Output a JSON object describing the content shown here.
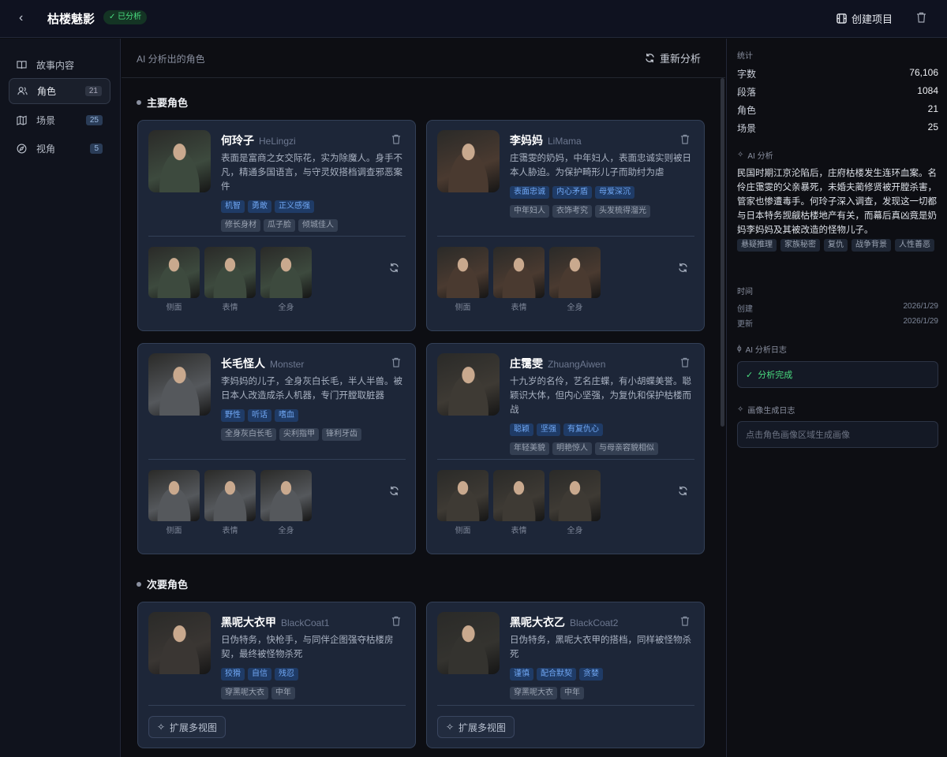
{
  "header": {
    "title": "枯楼魅影",
    "status_badge": "已分析",
    "create_label": "创建项目"
  },
  "sidebar": {
    "items": [
      {
        "label": "故事内容",
        "count": null,
        "icon": "book-icon"
      },
      {
        "label": "角色",
        "count": "21",
        "icon": "users-icon"
      },
      {
        "label": "场景",
        "count": "25",
        "icon": "map-icon"
      },
      {
        "label": "视角",
        "count": "5",
        "icon": "compass-icon"
      }
    ]
  },
  "main": {
    "subtitle": "AI 分析出的角色",
    "reanalyze_label": "重新分析",
    "primary_title": "主要角色",
    "secondary_title": "次要角色",
    "view_labels": [
      "侧面",
      "表情",
      "全身"
    ],
    "expand_label": "扩展多视图",
    "primary": [
      {
        "name": "何玲子",
        "en": "HeLingzi",
        "desc": "表面是富商之女交际花，实为除魔人。身手不凡，精通多国语言，与守灵奴搭档调查邪恶案件",
        "traits": [
          "机智",
          "勇敢",
          "正义感强"
        ],
        "looks": [
          "修长身材",
          "瓜子脸",
          "倾城佳人"
        ],
        "color": "#3d4a3e"
      },
      {
        "name": "李妈妈",
        "en": "LiMama",
        "desc": "庄霭雯的奶妈，中年妇人，表面忠诚实则被日本人胁迫。为保护畸形儿子而助纣为虐",
        "traits": [
          "表面忠诚",
          "内心矛盾",
          "母爱深沉"
        ],
        "looks": [
          "中年妇人",
          "衣饰考究",
          "头发梳得溜光"
        ],
        "color": "#4a3a30"
      },
      {
        "name": "长毛怪人",
        "en": "Monster",
        "desc": "李妈妈的儿子，全身灰白长毛，半人半兽。被日本人改造成杀人机器，专门开膛取脏器",
        "traits": [
          "野性",
          "听话",
          "嗜血"
        ],
        "looks": [
          "全身灰白长毛",
          "尖利指甲",
          "锋利牙齿"
        ],
        "color": "#55585c"
      },
      {
        "name": "庄霭雯",
        "en": "ZhuangAiwen",
        "desc": "十九岁的名伶，艺名庄蝶，有小胡蝶美誉。聪颖识大体，但内心坚强，为复仇和保护枯楼而战",
        "traits": [
          "聪颖",
          "坚强",
          "有复仇心"
        ],
        "looks": [
          "年轻美貌",
          "明艳惊人",
          "与母亲容貌相似"
        ],
        "color": "#3e3a34"
      }
    ],
    "secondary": [
      {
        "name": "黑呢大衣甲",
        "en": "BlackCoat1",
        "desc": "日伪特务，快枪手，与同伴企图强夺枯楼房契，最终被怪物杀死",
        "traits": [
          "狡猾",
          "自信",
          "残忍"
        ],
        "looks": [
          "穿黑呢大衣",
          "中年"
        ],
        "color": "#3a3633"
      },
      {
        "name": "黑呢大衣乙",
        "en": "BlackCoat2",
        "desc": "日伪特务，黑呢大衣甲的搭档，同样被怪物杀死",
        "traits": [
          "谨慎",
          "配合默契",
          "贪婪"
        ],
        "looks": [
          "穿黑呢大衣",
          "中年"
        ],
        "color": "#34332f"
      }
    ]
  },
  "right": {
    "stats_title": "统计",
    "stats": [
      {
        "label": "字数",
        "value": "76,106"
      },
      {
        "label": "段落",
        "value": "1084"
      },
      {
        "label": "角色",
        "value": "21"
      },
      {
        "label": "场景",
        "value": "25"
      }
    ],
    "ai_title": "AI 分析",
    "summary": "民国时期江京沦陷后，庄府枯楼发生连环血案。名伶庄霭雯的父亲暴死，未婚夫蔺修贤被开膛杀害，管家也惨遭毒手。何玲子深入调查，发现这一切都与日本特务觊觎枯楼地产有关，而幕后真凶竟是奶妈李妈妈及其被改造的怪物儿子。",
    "genres": [
      "悬疑推理",
      "家族秘密",
      "复仇",
      "战争背景",
      "人性善恶"
    ],
    "time_title": "时间",
    "created_label": "创建",
    "created": "2026/1/29",
    "updated_label": "更新",
    "updated": "2026/1/29",
    "log_title": "AI 分析日志",
    "log_status": "分析完成",
    "img_log_title": "画像生成日志",
    "img_log_placeholder": "点击角色画像区域生成画像"
  },
  "colors": {
    "accent": "#4ade80",
    "tag_blue": "#6fa6f2",
    "card_bg": "#1d2638"
  }
}
